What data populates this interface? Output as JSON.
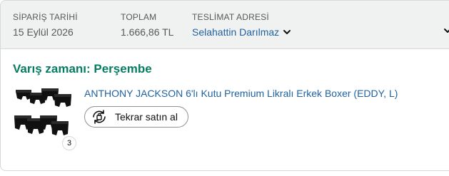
{
  "order": {
    "order_date_label": "SİPARİŞ TARİHİ",
    "order_date": "15 Eylül 2026",
    "total_label": "TOPLAM",
    "total": "1.666,86 TL",
    "ship_to_label": "TESLİMAT ADRESİ",
    "ship_to_name": "Selahattin Darılmaz"
  },
  "delivery": {
    "status": "Varış zamanı: Perşembe"
  },
  "item": {
    "title": "ANTHONY JACKSON 6'lı Kutu Premium Likralı Erkek Boxer (EDDY, L)",
    "quantity": "3",
    "buy_again_label": "Tekrar satın al",
    "image_icon": "black-boxer-briefs-product-image"
  },
  "colors": {
    "link": "#2162a1",
    "delivery_green": "#067d62",
    "header_bg": "#f0f2f2"
  }
}
